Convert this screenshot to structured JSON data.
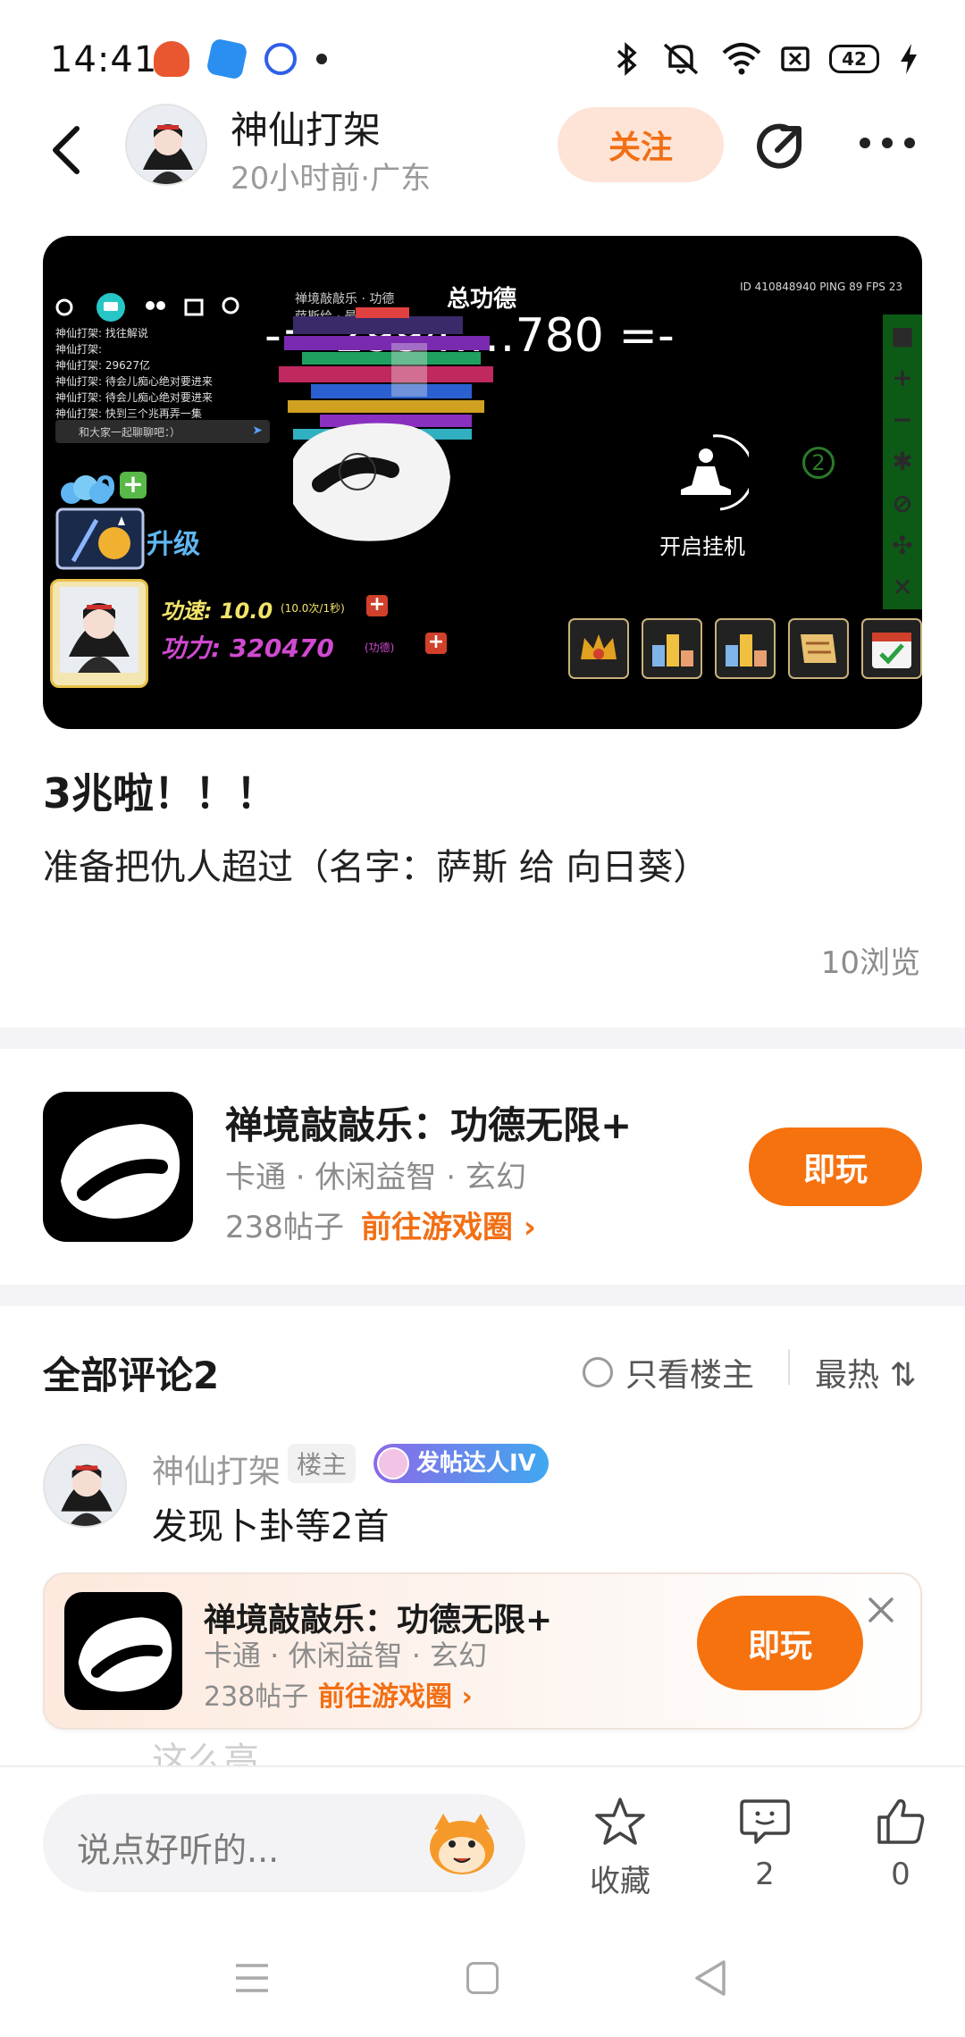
{
  "status_bar": {
    "time": "14:41",
    "battery": "42",
    "icons": [
      "app-notification-icon",
      "bluetooth-icon",
      "mute-icon",
      "wifi-icon",
      "sim-icon",
      "battery-icon",
      "charging-icon"
    ]
  },
  "header": {
    "author": "神仙打架",
    "meta": "20小时前·广东",
    "follow_label": "关注"
  },
  "screenshot": {
    "total_merit_label": "总功德",
    "total_merit_value": "-= 2994‥‥780 =-",
    "server_info": "ID 410848940   PING 89   FPS 23",
    "chat_lines": [
      "神仙打架: 找往解说",
      "神仙打架:",
      "神仙打架: 29627亿",
      "神仙打架: 待会儿痴心绝对要进来",
      "神仙打架: 待会儿痴心绝对要进来",
      "神仙打架: 快到三个兆再弄一集"
    ],
    "chat_input": "和大家一起聊聊吧：）",
    "cloud_count": "0",
    "upgrade_label": "升级",
    "speed_label": "功速: 10.0",
    "speed_unit": "(10.0次/1秒)",
    "power_label": "功力: 320470",
    "power_unit": "(功德)",
    "idle_label": "开启挂机",
    "side_badge": "2"
  },
  "post": {
    "title": "3兆啦！！！",
    "body": "准备把仇人超过（名字：萨斯 给 向日葵）",
    "views": "10浏览"
  },
  "game_card": {
    "title": "禅境敲敲乐：功德无限+",
    "tags": "卡通 · 休闲益智 · 玄幻",
    "posts": "238帖子",
    "circle_link": "前往游戏圈 ›",
    "play_label": "即玩"
  },
  "comments": {
    "title": "全部评论2",
    "only_op": "只看楼主",
    "sort": "最热 ⇅",
    "items": [
      {
        "name": "神仙打架",
        "op_badge": "楼主",
        "level_badge": "发帖达人IV",
        "text": "发现卜卦等2首"
      }
    ],
    "peek": "这么高"
  },
  "banner": {
    "title": "禅境敲敲乐：功德无限+",
    "tags": "卡通 · 休闲益智 · 玄幻",
    "posts": "238帖子",
    "circle_link": "前往游戏圈 ›",
    "play_label": "即玩"
  },
  "bottom_bar": {
    "input_placeholder": "说点好听的...",
    "favorite_label": "收藏",
    "comment_count": "2",
    "like_count": "0"
  },
  "colors": {
    "accent": "#f6720e",
    "follow_bg": "#fde4d7",
    "muted_text": "#8c8c8c"
  }
}
